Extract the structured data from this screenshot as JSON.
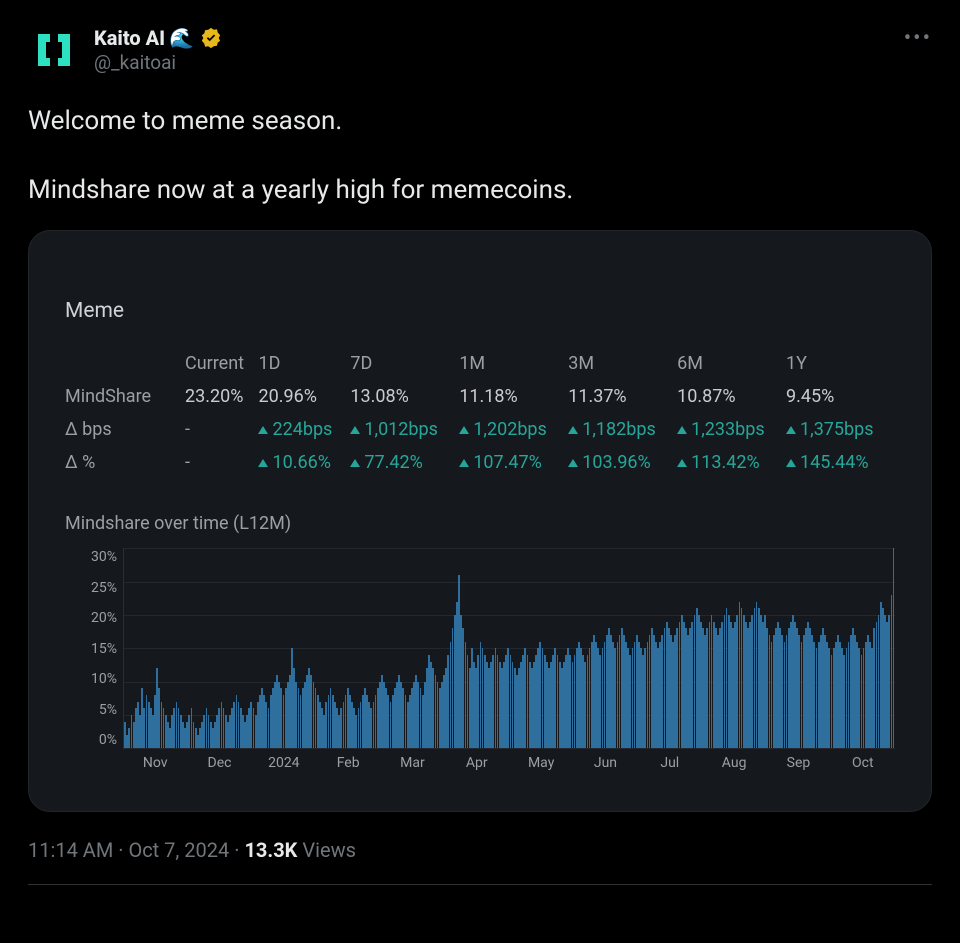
{
  "author": {
    "display_name": "Kaito AI",
    "emoji": "🌊",
    "handle": "@_kaitoai",
    "verified": true
  },
  "tweet": {
    "line1": "Welcome to meme season.",
    "line2": "Mindshare now at a yearly high for memecoins."
  },
  "panel": {
    "title": "Meme",
    "columns": [
      "Current",
      "1D",
      "7D",
      "1M",
      "3M",
      "6M",
      "1Y"
    ],
    "rows": {
      "mindshare_label": "MindShare",
      "mindshare": [
        "23.20%",
        "20.96%",
        "13.08%",
        "11.18%",
        "11.37%",
        "10.87%",
        "9.45%"
      ],
      "dbps_label": "Δ bps",
      "dbps": [
        "-",
        "224bps",
        "1,012bps",
        "1,202bps",
        "1,182bps",
        "1,233bps",
        "1,375bps"
      ],
      "dpct_label": "Δ %",
      "dpct": [
        "-",
        "10.66%",
        "77.42%",
        "107.47%",
        "103.96%",
        "113.42%",
        "145.44%"
      ]
    },
    "chart_data": {
      "type": "bar",
      "title": "Mindshare over time (L12M)",
      "ylabel": "",
      "xlabel": "",
      "ylim": [
        0,
        30
      ],
      "yticks": [
        "30%",
        "25%",
        "20%",
        "15%",
        "10%",
        "5%",
        "0%"
      ],
      "categories": [
        "Nov",
        "Dec",
        "2024",
        "Feb",
        "Mar",
        "Apr",
        "May",
        "Jun",
        "Jul",
        "Aug",
        "Sep",
        "Oct"
      ],
      "values_pct": [
        4,
        2,
        3,
        5,
        4,
        6,
        7,
        5,
        9,
        6,
        8,
        7,
        6,
        5,
        8,
        12,
        9,
        7,
        6,
        5,
        4,
        3,
        5,
        6,
        7,
        6,
        5,
        4,
        3,
        4,
        5,
        6,
        4,
        3,
        2,
        3,
        4,
        5,
        6,
        5,
        4,
        3,
        4,
        5,
        6,
        7,
        6,
        5,
        4,
        5,
        6,
        7,
        8,
        7,
        6,
        5,
        4,
        5,
        6,
        7,
        6,
        5,
        7,
        8,
        9,
        8,
        7,
        6,
        8,
        9,
        10,
        11,
        10,
        9,
        8,
        9,
        10,
        11,
        15,
        12,
        10,
        9,
        8,
        9,
        10,
        11,
        12,
        11,
        10,
        9,
        8,
        7,
        6,
        5,
        7,
        8,
        9,
        8,
        7,
        6,
        5,
        6,
        7,
        8,
        9,
        8,
        7,
        6,
        5,
        6,
        7,
        8,
        9,
        8,
        7,
        6,
        7,
        8,
        9,
        10,
        11,
        10,
        9,
        8,
        7,
        8,
        9,
        10,
        11,
        10,
        9,
        8,
        7,
        8,
        9,
        10,
        11,
        10,
        9,
        8,
        10,
        12,
        14,
        13,
        12,
        11,
        10,
        9,
        10,
        11,
        12,
        14,
        16,
        18,
        20,
        22,
        26,
        20,
        18,
        16,
        14,
        12,
        15,
        13,
        12,
        14,
        16,
        15,
        14,
        13,
        12,
        13,
        14,
        15,
        14,
        13,
        12,
        13,
        14,
        15,
        14,
        13,
        12,
        11,
        12,
        13,
        14,
        15,
        14,
        13,
        12,
        13,
        14,
        15,
        16,
        15,
        14,
        13,
        12,
        13,
        14,
        15,
        14,
        13,
        12,
        13,
        14,
        15,
        14,
        13,
        14,
        15,
        16,
        15,
        14,
        13,
        14,
        15,
        16,
        17,
        16,
        15,
        14,
        15,
        16,
        17,
        18,
        17,
        16,
        15,
        16,
        17,
        18,
        17,
        16,
        15,
        14,
        15,
        16,
        17,
        16,
        15,
        14,
        15,
        16,
        17,
        18,
        17,
        16,
        15,
        16,
        17,
        18,
        19,
        18,
        17,
        16,
        17,
        18,
        19,
        20,
        19,
        18,
        17,
        18,
        19,
        20,
        21,
        20,
        19,
        18,
        17,
        18,
        19,
        20,
        19,
        18,
        17,
        18,
        19,
        20,
        21,
        20,
        19,
        18,
        19,
        20,
        22,
        21,
        20,
        19,
        18,
        19,
        20,
        21,
        22,
        21,
        20,
        19,
        20,
        18,
        17,
        16,
        17,
        18,
        19,
        18,
        17,
        16,
        17,
        18,
        19,
        20,
        19,
        18,
        17,
        16,
        17,
        18,
        19,
        18,
        17,
        16,
        15,
        16,
        17,
        18,
        17,
        16,
        15,
        14,
        15,
        16,
        17,
        16,
        15,
        14,
        15,
        16,
        17,
        18,
        17,
        16,
        15,
        14,
        15,
        16,
        17,
        16,
        15,
        18,
        19,
        20,
        22,
        21,
        20,
        19,
        20,
        23,
        30
      ]
    }
  },
  "meta": {
    "time": "11:14 AM",
    "date": "Oct 7, 2024",
    "views_count": "13.3K",
    "views_label": "Views"
  }
}
